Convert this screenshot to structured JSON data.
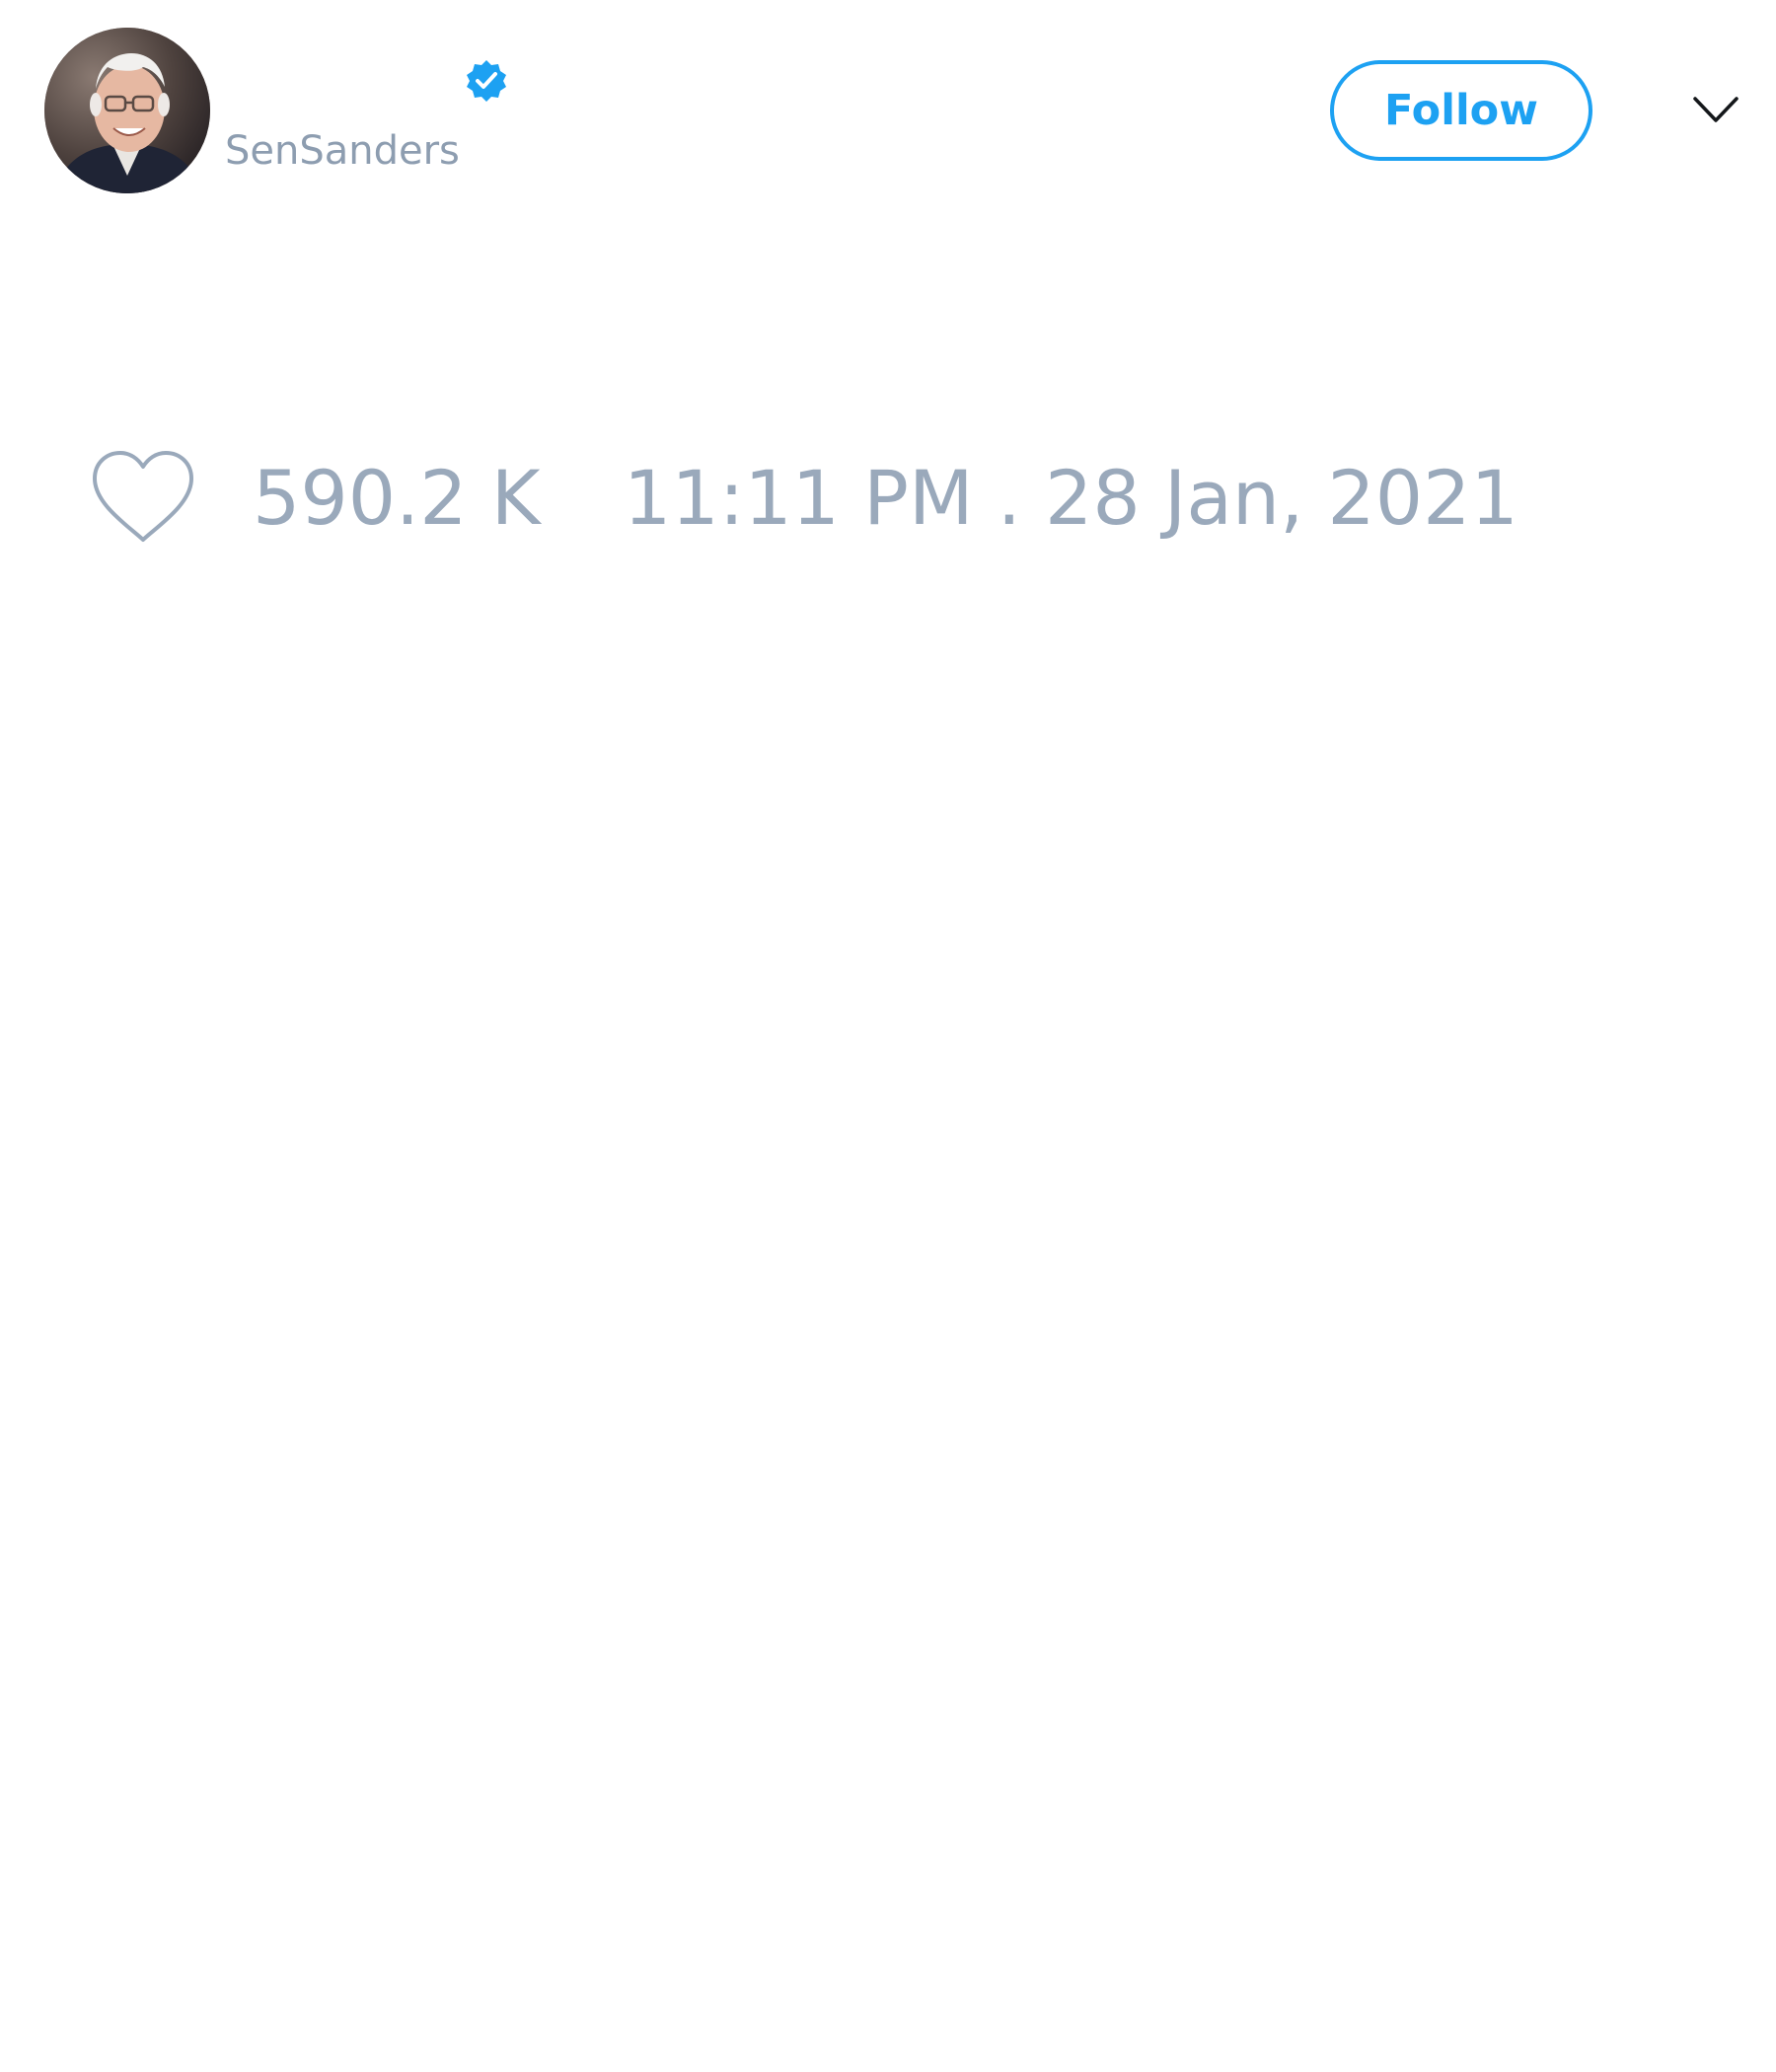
{
  "tweet": {
    "display_name": "",
    "handle": "SenSanders",
    "verified": true,
    "follow_label": "Follow",
    "likes": "590.2 K",
    "timestamp": "11:11 PM . 28 Jan, 2021"
  },
  "icons": {
    "avatar": "profile-photo",
    "verified": "verified-badge-icon",
    "menu": "chevron-down-icon",
    "like": "heart-outline-icon"
  },
  "colors": {
    "accent": "#1da1f2",
    "muted_text": "#9aa9bb",
    "handle_text": "#8d9db0",
    "background": "#ffffff"
  }
}
